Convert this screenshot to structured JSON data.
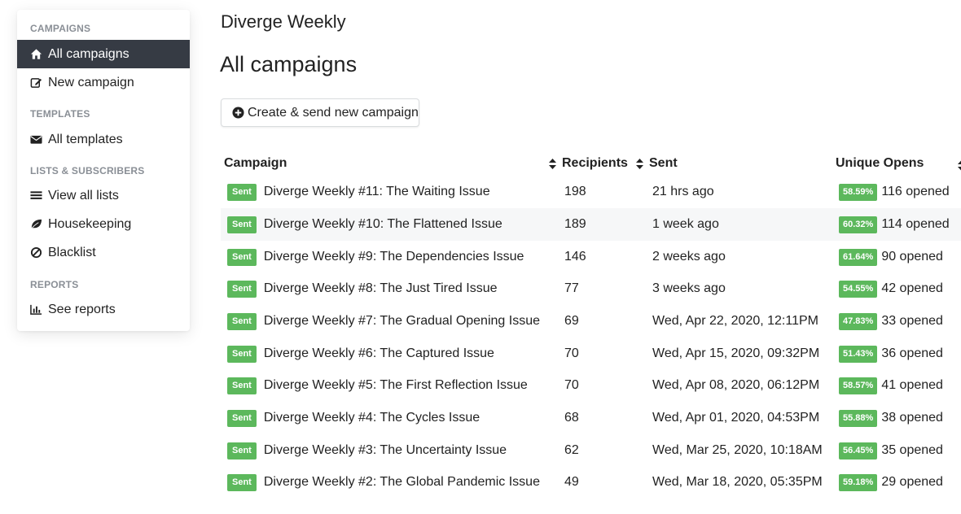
{
  "sidebar": {
    "sections": [
      {
        "heading": "CAMPAIGNS"
      },
      {
        "heading": "TEMPLATES"
      },
      {
        "heading": "LISTS & SUBSCRIBERS"
      },
      {
        "heading": "REPORTS"
      }
    ],
    "items": [
      {
        "label": "All campaigns",
        "icon": "home-icon",
        "active": true
      },
      {
        "label": "New campaign",
        "icon": "edit-icon"
      },
      {
        "label": "All templates",
        "icon": "envelope-icon"
      },
      {
        "label": "View all lists",
        "icon": "list-icon"
      },
      {
        "label": "Housekeeping",
        "icon": "leaf-icon"
      },
      {
        "label": "Blacklist",
        "icon": "ban-icon"
      },
      {
        "label": "See reports",
        "icon": "bar-chart-icon"
      }
    ],
    "active_color": "#363b44"
  },
  "header": {
    "app_title": "Diverge Weekly",
    "page_title": "All campaigns",
    "create_button_label": "Create & send new campaign"
  },
  "table": {
    "columns": [
      "Campaign",
      "Recipients",
      "Sent",
      "Unique Opens"
    ],
    "badge_color": "#5cb85c",
    "rows": [
      {
        "status": "Sent",
        "name": "Diverge Weekly #11: The Waiting Issue",
        "recipients": "198",
        "sent": "21 hrs ago",
        "open_pct": "58.59%",
        "opened": "116 opened"
      },
      {
        "status": "Sent",
        "name": "Diverge Weekly #10: The Flattened Issue",
        "recipients": "189",
        "sent": "1 week ago",
        "open_pct": "60.32%",
        "opened": "114 opened"
      },
      {
        "status": "Sent",
        "name": "Diverge Weekly #9: The Dependencies Issue",
        "recipients": "146",
        "sent": "2 weeks ago",
        "open_pct": "61.64%",
        "opened": "90 opened"
      },
      {
        "status": "Sent",
        "name": "Diverge Weekly #8: The Just Tired Issue",
        "recipients": "77",
        "sent": "3 weeks ago",
        "open_pct": "54.55%",
        "opened": "42 opened"
      },
      {
        "status": "Sent",
        "name": "Diverge Weekly #7: The Gradual Opening Issue",
        "recipients": "69",
        "sent": "Wed, Apr 22, 2020, 12:11PM",
        "open_pct": "47.83%",
        "opened": "33 opened"
      },
      {
        "status": "Sent",
        "name": "Diverge Weekly #6: The Captured Issue",
        "recipients": "70",
        "sent": "Wed, Apr 15, 2020, 09:32PM",
        "open_pct": "51.43%",
        "opened": "36 opened"
      },
      {
        "status": "Sent",
        "name": "Diverge Weekly #5: The First Reflection Issue",
        "recipients": "70",
        "sent": "Wed, Apr 08, 2020, 06:12PM",
        "open_pct": "58.57%",
        "opened": "41 opened"
      },
      {
        "status": "Sent",
        "name": "Diverge Weekly #4: The Cycles Issue",
        "recipients": "68",
        "sent": "Wed, Apr 01, 2020, 04:53PM",
        "open_pct": "55.88%",
        "opened": "38 opened"
      },
      {
        "status": "Sent",
        "name": "Diverge Weekly #3: The Uncertainty Issue",
        "recipients": "62",
        "sent": "Wed, Mar 25, 2020, 10:18AM",
        "open_pct": "56.45%",
        "opened": "35 opened"
      },
      {
        "status": "Sent",
        "name": "Diverge Weekly #2: The Global Pandemic Issue",
        "recipients": "49",
        "sent": "Wed, Mar 18, 2020, 05:35PM",
        "open_pct": "59.18%",
        "opened": "29 opened"
      }
    ]
  }
}
